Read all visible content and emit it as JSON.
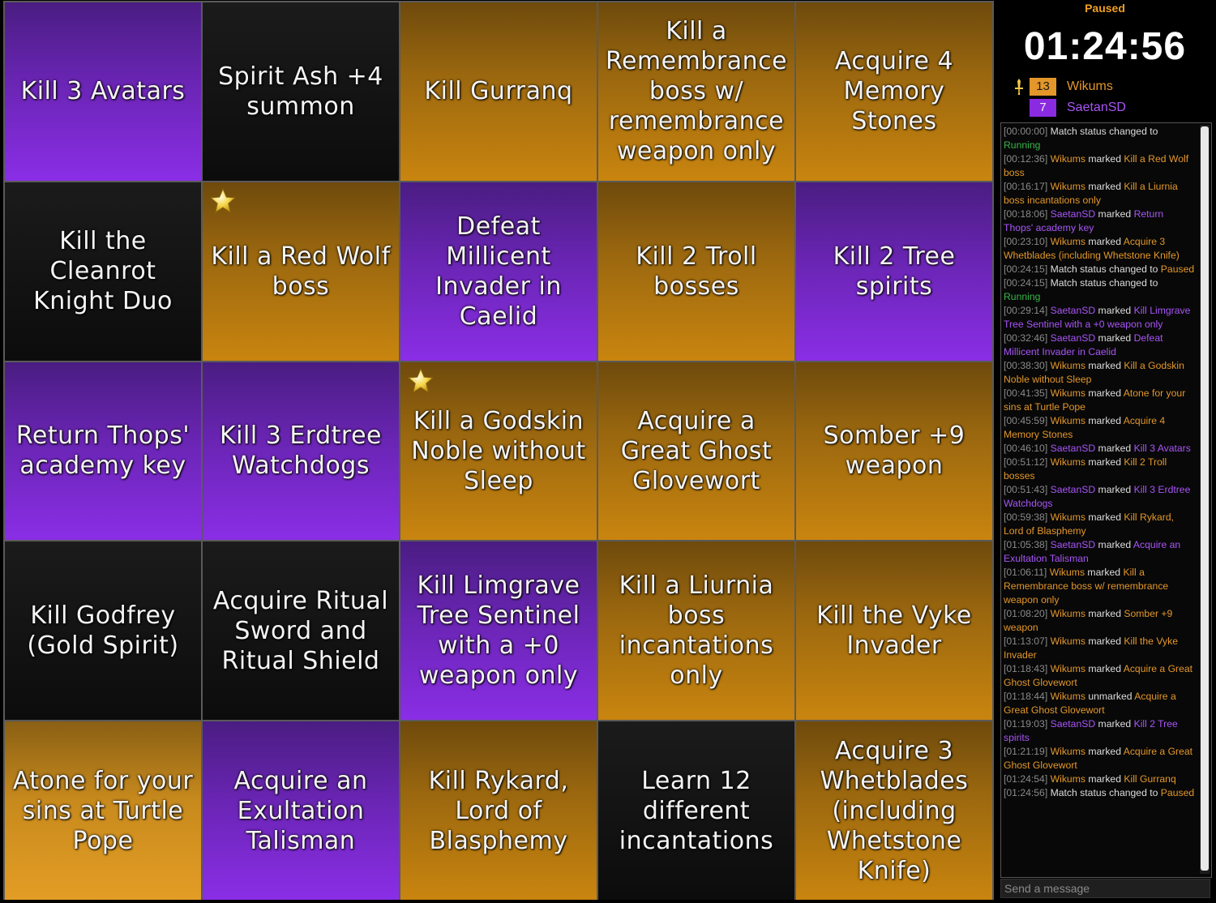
{
  "board": {
    "cells": [
      {
        "text": "Kill 3 Avatars",
        "owner": "purple"
      },
      {
        "text": "Spirit Ash +4 summon",
        "owner": "none"
      },
      {
        "text": "Kill Gurranq",
        "owner": "orange"
      },
      {
        "text": "Kill a Remembrance boss w/ remembrance weapon only",
        "owner": "orange"
      },
      {
        "text": "Acquire 4 Memory Stones",
        "owner": "orange"
      },
      {
        "text": "Kill the Cleanrot Knight Duo",
        "owner": "none"
      },
      {
        "text": "Kill a Red Wolf boss",
        "owner": "orange",
        "star": true
      },
      {
        "text": "Defeat Millicent Invader in Caelid",
        "owner": "purple"
      },
      {
        "text": "Kill 2 Troll bosses",
        "owner": "orange"
      },
      {
        "text": "Kill 2 Tree spirits",
        "owner": "purple"
      },
      {
        "text": "Return Thops' academy key",
        "owner": "purple"
      },
      {
        "text": "Kill 3 Erdtree Watchdogs",
        "owner": "purple"
      },
      {
        "text": "Kill a Godskin Noble without Sleep",
        "owner": "orange",
        "star": true
      },
      {
        "text": "Acquire a Great Ghost Glovewort",
        "owner": "orange"
      },
      {
        "text": "Somber +9 weapon",
        "owner": "orange"
      },
      {
        "text": "Kill Godfrey (Gold Spirit)",
        "owner": "none"
      },
      {
        "text": "Acquire Ritual Sword and Ritual Shield",
        "owner": "none"
      },
      {
        "text": "Kill Limgrave Tree Sentinel with a +0 weapon only",
        "owner": "purple"
      },
      {
        "text": "Kill a Liurnia boss incantations only",
        "owner": "orange"
      },
      {
        "text": "Kill the Vyke Invader",
        "owner": "orange"
      },
      {
        "text": "Atone for your sins at Turtle Pope",
        "owner": "orange",
        "light": true
      },
      {
        "text": "Acquire an Exultation Talisman",
        "owner": "purple"
      },
      {
        "text": "Kill Rykard, Lord of Blasphemy",
        "owner": "orange"
      },
      {
        "text": "Learn 12 different incantations",
        "owner": "none"
      },
      {
        "text": "Acquire 3 Whetblades (including Whetstone Knife)",
        "owner": "orange"
      }
    ]
  },
  "colors": {
    "orange": "#e3972a",
    "purple": "#8a2be2",
    "running": "#39b54a"
  },
  "status": "Paused",
  "timer": "01:24:56",
  "players": [
    {
      "score": "13",
      "name": "Wikums",
      "color": "#e3972a",
      "leader_icon": "sword-icon"
    },
    {
      "score": "7",
      "name": "SaetanSD",
      "color": "#8a2be2"
    }
  ],
  "log": [
    {
      "time": "[00:00:00]",
      "segments": [
        {
          "t": "Match status changed to ",
          "c": ""
        },
        {
          "t": "Running",
          "c": "g"
        }
      ]
    },
    {
      "time": "[00:12:36]",
      "segments": [
        {
          "t": "Wikums",
          "c": "o"
        },
        {
          "t": " marked ",
          "c": ""
        },
        {
          "t": "Kill a Red Wolf boss",
          "c": "o"
        }
      ]
    },
    {
      "time": "[00:16:17]",
      "segments": [
        {
          "t": "Wikums",
          "c": "o"
        },
        {
          "t": " marked ",
          "c": ""
        },
        {
          "t": "Kill a Liurnia boss incantations only",
          "c": "o"
        }
      ]
    },
    {
      "time": "[00:18:06]",
      "segments": [
        {
          "t": "SaetanSD",
          "c": "p"
        },
        {
          "t": " marked ",
          "c": ""
        },
        {
          "t": "Return Thops' academy key",
          "c": "p"
        }
      ]
    },
    {
      "time": "[00:23:10]",
      "segments": [
        {
          "t": "Wikums",
          "c": "o"
        },
        {
          "t": " marked ",
          "c": ""
        },
        {
          "t": "Acquire 3 Whetblades (including Whetstone Knife)",
          "c": "o"
        }
      ]
    },
    {
      "time": "[00:24:15]",
      "segments": [
        {
          "t": "Match status changed to ",
          "c": ""
        },
        {
          "t": "Paused",
          "c": "o"
        }
      ]
    },
    {
      "time": "[00:24:15]",
      "segments": [
        {
          "t": "Match status changed to ",
          "c": ""
        },
        {
          "t": "Running",
          "c": "g"
        }
      ]
    },
    {
      "time": "[00:29:14]",
      "segments": [
        {
          "t": "SaetanSD",
          "c": "p"
        },
        {
          "t": " marked ",
          "c": ""
        },
        {
          "t": "Kill Limgrave Tree Sentinel with a +0 weapon only",
          "c": "p"
        }
      ]
    },
    {
      "time": "[00:32:46]",
      "segments": [
        {
          "t": "SaetanSD",
          "c": "p"
        },
        {
          "t": " marked ",
          "c": ""
        },
        {
          "t": "Defeat Millicent Invader in Caelid",
          "c": "p"
        }
      ]
    },
    {
      "time": "[00:38:30]",
      "segments": [
        {
          "t": "Wikums",
          "c": "o"
        },
        {
          "t": " marked ",
          "c": ""
        },
        {
          "t": "Kill a Godskin Noble without Sleep",
          "c": "o"
        }
      ]
    },
    {
      "time": "[00:41:35]",
      "segments": [
        {
          "t": "Wikums",
          "c": "o"
        },
        {
          "t": " marked ",
          "c": ""
        },
        {
          "t": "Atone for your sins at Turtle Pope",
          "c": "o"
        }
      ]
    },
    {
      "time": "[00:45:59]",
      "segments": [
        {
          "t": "Wikums",
          "c": "o"
        },
        {
          "t": " marked ",
          "c": ""
        },
        {
          "t": "Acquire 4 Memory Stones",
          "c": "o"
        }
      ]
    },
    {
      "time": "[00:46:10]",
      "segments": [
        {
          "t": "SaetanSD",
          "c": "p"
        },
        {
          "t": " marked ",
          "c": ""
        },
        {
          "t": "Kill 3 Avatars",
          "c": "p"
        }
      ]
    },
    {
      "time": "[00:51:12]",
      "segments": [
        {
          "t": "Wikums",
          "c": "o"
        },
        {
          "t": " marked ",
          "c": ""
        },
        {
          "t": "Kill 2 Troll bosses",
          "c": "o"
        }
      ]
    },
    {
      "time": "[00:51:43]",
      "segments": [
        {
          "t": "SaetanSD",
          "c": "p"
        },
        {
          "t": " marked ",
          "c": ""
        },
        {
          "t": "Kill 3 Erdtree Watchdogs",
          "c": "p"
        }
      ]
    },
    {
      "time": "[00:59:38]",
      "segments": [
        {
          "t": "Wikums",
          "c": "o"
        },
        {
          "t": " marked ",
          "c": ""
        },
        {
          "t": "Kill Rykard, Lord of Blasphemy",
          "c": "o"
        }
      ]
    },
    {
      "time": "[01:05:38]",
      "segments": [
        {
          "t": "SaetanSD",
          "c": "p"
        },
        {
          "t": " marked ",
          "c": ""
        },
        {
          "t": "Acquire an Exultation Talisman",
          "c": "p"
        }
      ]
    },
    {
      "time": "[01:06:11]",
      "segments": [
        {
          "t": "Wikums",
          "c": "o"
        },
        {
          "t": " marked ",
          "c": ""
        },
        {
          "t": "Kill a Remembrance boss w/ remembrance weapon only",
          "c": "o"
        }
      ]
    },
    {
      "time": "[01:08:20]",
      "segments": [
        {
          "t": "Wikums",
          "c": "o"
        },
        {
          "t": " marked ",
          "c": ""
        },
        {
          "t": "Somber +9 weapon",
          "c": "o"
        }
      ]
    },
    {
      "time": "[01:13:07]",
      "segments": [
        {
          "t": "Wikums",
          "c": "o"
        },
        {
          "t": " marked ",
          "c": ""
        },
        {
          "t": "Kill the Vyke Invader",
          "c": "o"
        }
      ]
    },
    {
      "time": "[01:18:43]",
      "segments": [
        {
          "t": "Wikums",
          "c": "o"
        },
        {
          "t": " marked ",
          "c": ""
        },
        {
          "t": "Acquire a Great Ghost Glovewort",
          "c": "o"
        }
      ]
    },
    {
      "time": "[01:18:44]",
      "segments": [
        {
          "t": "Wikums",
          "c": "o"
        },
        {
          "t": " unmarked ",
          "c": ""
        },
        {
          "t": "Acquire a Great Ghost Glovewort",
          "c": "o"
        }
      ]
    },
    {
      "time": "[01:19:03]",
      "segments": [
        {
          "t": "SaetanSD",
          "c": "p"
        },
        {
          "t": " marked ",
          "c": ""
        },
        {
          "t": "Kill 2 Tree spirits",
          "c": "p"
        }
      ]
    },
    {
      "time": "[01:21:19]",
      "segments": [
        {
          "t": "Wikums",
          "c": "o"
        },
        {
          "t": " marked ",
          "c": ""
        },
        {
          "t": "Acquire a Great Ghost Glovewort",
          "c": "o"
        }
      ]
    },
    {
      "time": "[01:24:54]",
      "segments": [
        {
          "t": "Wikums",
          "c": "o"
        },
        {
          "t": " marked ",
          "c": ""
        },
        {
          "t": "Kill Gurranq",
          "c": "o"
        }
      ]
    },
    {
      "time": "[01:24:56]",
      "segments": [
        {
          "t": "Match status changed to ",
          "c": ""
        },
        {
          "t": "Paused",
          "c": "o"
        }
      ]
    }
  ],
  "chat": {
    "placeholder": "Send a message"
  }
}
